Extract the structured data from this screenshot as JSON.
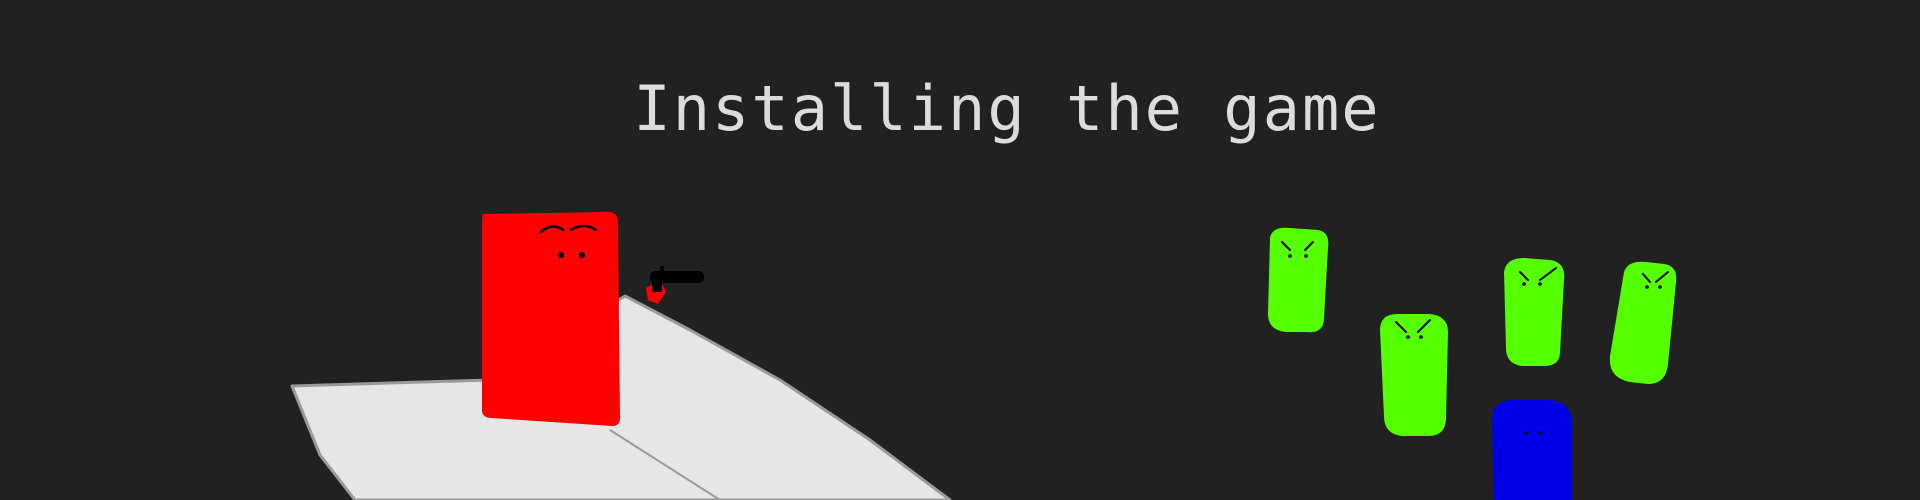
{
  "scene": {
    "title": "Installing the game",
    "colors": {
      "background": "#212121",
      "title_text": "#dcdcdc",
      "ramp_fill": "#e6e6e6",
      "ramp_outline": "#9a9a9a",
      "player": "#ff0000",
      "enemy_green": "#55ff00",
      "enemy_blue": "#0000e6",
      "gun": "#000000"
    },
    "player": {
      "name": "red-block-player",
      "weapon": "gun-icon"
    },
    "enemies": [
      {
        "name": "green-enemy-1",
        "color": "#55ff00",
        "mood": "angry"
      },
      {
        "name": "green-enemy-2",
        "color": "#55ff00",
        "mood": "angry"
      },
      {
        "name": "green-enemy-3",
        "color": "#55ff00",
        "mood": "angry"
      },
      {
        "name": "green-enemy-4",
        "color": "#55ff00",
        "mood": "angry"
      },
      {
        "name": "blue-enemy",
        "color": "#0000e6",
        "mood": "neutral"
      }
    ]
  }
}
